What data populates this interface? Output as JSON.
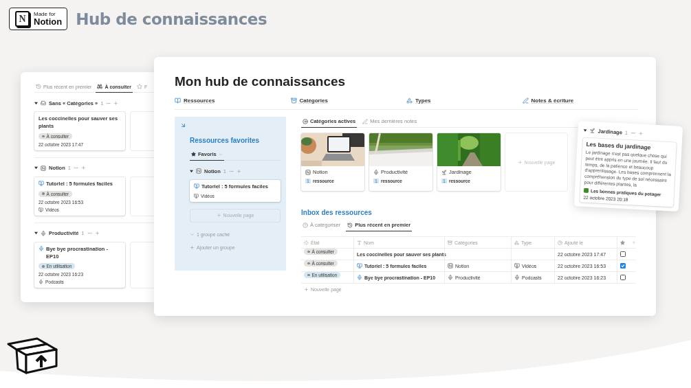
{
  "header": {
    "badge": {
      "letter": "N",
      "line_1": "Made for",
      "line_2": "Notion"
    },
    "title": "Hub de connaissances"
  },
  "board": {
    "tabs": [
      {
        "label": "Plus récent en premier",
        "kind": "recent",
        "selected": false
      },
      {
        "label": "À consulter",
        "kind": "consult",
        "selected": true
      },
      {
        "label": "F",
        "kind": "star",
        "selected": false
      }
    ],
    "groups": [
      {
        "name": "Sans « Catégories »",
        "kind": "none",
        "count": "1",
        "cards": [
          {
            "title": "Les coccinelles pour sauver ses plants",
            "status": {
              "label": "À consulter",
              "color": "#e3e2e0"
            },
            "date": "22 octobre 2023 17:47"
          }
        ]
      },
      {
        "name": "Notion",
        "kind": "notion",
        "count": "1",
        "cards": [
          {
            "title": "Tutoriel : 5 formules faciles",
            "kind": "video",
            "status": {
              "label": "À consulter",
              "color": "#e3e2e0"
            },
            "date": "22 octobre 2023 16:53",
            "type": {
              "label": "Vidéos",
              "kind": "video"
            }
          }
        ]
      },
      {
        "name": "Productivité",
        "kind": "productivity",
        "count": "1",
        "cards": [
          {
            "title": "Bye bye procrastination - EP10",
            "kind": "podcast",
            "status": {
              "label": "En utilisation",
              "color": "#d3e5ef"
            },
            "date": "22 octobre 2023 16:23",
            "type": {
              "label": "Podcasts",
              "kind": "podcast"
            }
          }
        ]
      }
    ]
  },
  "main": {
    "title": "Mon hub de connaissances",
    "links": [
      {
        "label": "Ressources",
        "kind": "book"
      },
      {
        "label": "Catégories",
        "kind": "archive"
      },
      {
        "label": "Types",
        "kind": "shapes"
      },
      {
        "label": "Notes & écriture",
        "kind": "notes"
      }
    ],
    "favorites": {
      "title": "Ressources favorites",
      "view": "Favoris",
      "group": {
        "name": "Notion",
        "kind": "notion",
        "count": "1"
      },
      "card": {
        "title": "Tutoriel : 5 formules faciles",
        "kind": "video",
        "type": {
          "label": "Vidéos",
          "kind": "video"
        }
      },
      "new_page": "Nouvelle page",
      "hidden_groups": "1 groupe caché",
      "add_group": "Ajouter un groupe"
    },
    "gallery": {
      "tabs": [
        {
          "label": "Catégories actives",
          "kind": "active",
          "selected": true
        },
        {
          "label": "Mes dernières notes",
          "kind": "notes",
          "selected": false
        }
      ],
      "cards": [
        {
          "name": "Notion",
          "kind": "notion",
          "count": "1",
          "count_label": "ressource"
        },
        {
          "name": "Productivité",
          "kind": "productivity",
          "count": "1",
          "count_label": "ressource"
        },
        {
          "name": "Jardinage",
          "kind": "garden",
          "count": "1",
          "count_label": "ressource"
        }
      ],
      "new_page": "Nouvelle page"
    },
    "inbox": {
      "title": "Inbox des ressources",
      "tabs": [
        {
          "label": "À catégoriser",
          "kind": "help",
          "selected": false
        },
        {
          "label": "Plus récent en premier",
          "kind": "recent",
          "selected": true
        }
      ],
      "columns": [
        {
          "label": "État",
          "kind": "status"
        },
        {
          "label": "Nom",
          "kind": "text"
        },
        {
          "label": "Catégories",
          "kind": "archive"
        },
        {
          "label": "Type",
          "kind": "shapes"
        },
        {
          "label": "Ajouté le",
          "kind": "clock"
        }
      ],
      "rows": [
        {
          "status": {
            "label": "À consulter",
            "color": "#e3e2e0"
          },
          "name": "Les coccinelles pour sauver ses plants",
          "added": "22 octobre 2023 17:47",
          "checked": false
        },
        {
          "status": {
            "label": "À consulter",
            "color": "#e3e2e0"
          },
          "name": "Tutoriel : 5 formules faciles",
          "kind": "video",
          "category": {
            "label": "Notion",
            "kind": "notion"
          },
          "type": {
            "label": "Vidéos",
            "kind": "video"
          },
          "added": "22 octobre 2023 16:53",
          "checked": true
        },
        {
          "status": {
            "label": "En utilisation",
            "color": "#d3e5ef"
          },
          "name": "Bye bye procrastination - EP10",
          "kind": "podcast",
          "category": {
            "label": "Productivité",
            "kind": "productivity"
          },
          "type": {
            "label": "Podcasts",
            "kind": "podcast"
          },
          "added": "22 octobre 2023 16:23",
          "checked": false
        }
      ],
      "new_page": "Nouvelle page"
    }
  },
  "floating_card": {
    "group": {
      "name": "Jardinage",
      "kind": "garden",
      "count": "1"
    },
    "title": "Les bases du jardinage",
    "excerpt": "Le jardinage n'est pas quelque chose qui peut être appris en une journée. Il faut du temps, de la patience et beaucoup d'apprentissage. Les bases comprennent la compréhension du type de sol nécessaire pour différentes plantes, la",
    "link": "Les bonnes pratiques du potager",
    "date": "22 octobre 2023 20:18"
  }
}
